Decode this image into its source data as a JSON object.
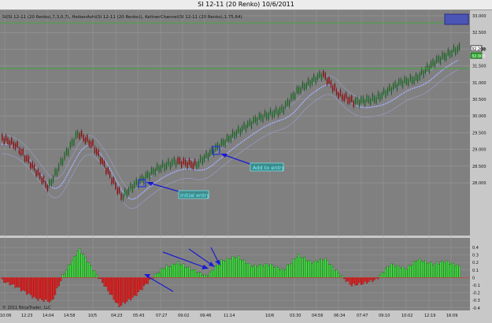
{
  "window": {
    "title": "SI 12-11 (20 Renko)  10/6/2011"
  },
  "header": {
    "indicator_line": "SI(SI 12-11 (20 Renko),7,3,0,7), HeikenAshi(SI 12-11 (20 Renko)), KeltnerChannel(SI 12-11 (20 Renko),1.75,64)"
  },
  "price_panel": {
    "y_ticks": [
      "33.000",
      "32.500",
      "32.000",
      "31.500",
      "31.000",
      "30.500",
      "30.000",
      "29.500",
      "29.000",
      "28.500",
      "28.000"
    ],
    "current_price_tag": "32.200",
    "second_price_tag": "32.000",
    "annotations": {
      "initial_entry": "Initial entry",
      "add_to_entry": "Add to entry"
    }
  },
  "oscillator_panel": {
    "y_ticks": [
      "0.4",
      "0.3",
      "0.2",
      "0.1",
      "0",
      "-0.1",
      "-0.2",
      "-0.3",
      "-0.4"
    ],
    "copyright": "© 2011 NinjaTrader, LLC"
  },
  "x_axis": {
    "labels": [
      "10:06",
      "12:23",
      "14:04",
      "14:58",
      "10/5",
      "04:23",
      "05:43",
      "07:27",
      "09:02",
      "09:46",
      "11:14",
      "10/6",
      "03:30",
      "04:56",
      "06:34",
      "07:47",
      "09:10",
      "10:02",
      "12:19",
      "16:09"
    ]
  },
  "colors": {
    "background": "#808080",
    "grid": "#9e9e9e",
    "up_bar": "#2f8a3a",
    "down_bar": "#b51d1d",
    "keltner_mid": "#a9b0ff",
    "keltner_band": "#9a9ac8",
    "osc_pos": "#3cf03c",
    "osc_neg": "#ff1a1a",
    "annotation_text": "#7ff5ff",
    "arrow": "#1a1ad2",
    "horizontal_line": "#3fa83f"
  }
}
